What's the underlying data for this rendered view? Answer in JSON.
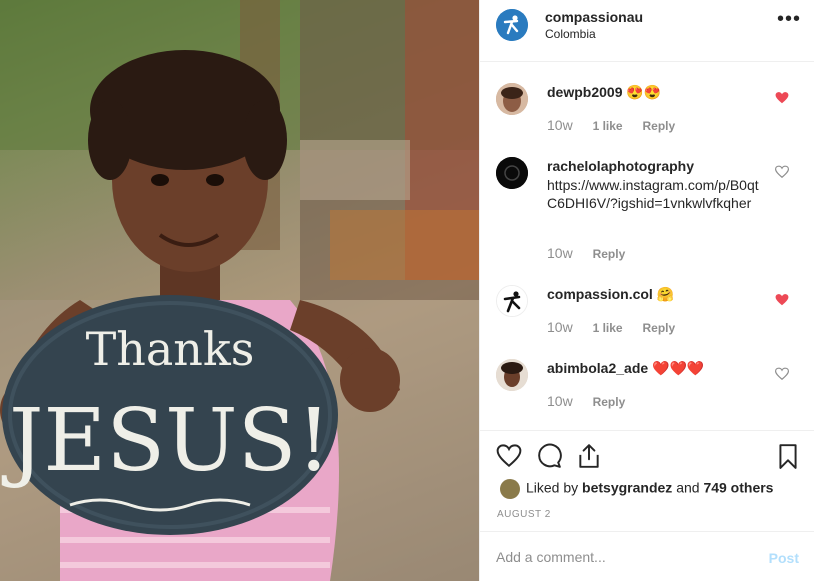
{
  "post": {
    "photo_text_line1": "Thanks",
    "photo_text_line2": "JESUS!"
  },
  "header": {
    "username": "compassionau",
    "location": "Colombia",
    "more_icon": "more-horizontal-icon",
    "more_label": "•••"
  },
  "comments": [
    {
      "username": "dewpb2009",
      "emoji": "😍😍",
      "text": "",
      "time": "10w",
      "likes": "1 like",
      "reply": "Reply",
      "liked": true
    },
    {
      "username": "rachelolaphotography",
      "emoji": "",
      "text": "https://www.instagram.com/p/B0qtC6DHI6V/?igshid=1vnkwlvfkqher",
      "time": "10w",
      "likes": "",
      "reply": "Reply",
      "liked": false
    },
    {
      "username": "compassion.col",
      "emoji": "🤗",
      "text": "",
      "time": "10w",
      "likes": "1 like",
      "reply": "Reply",
      "liked": true
    },
    {
      "username": "abimbola2_ade",
      "emoji": "❤️❤️❤️",
      "text": "",
      "time": "10w",
      "likes": "",
      "reply": "Reply",
      "liked": false
    }
  ],
  "actions": {
    "liked_by_prefix": "Liked by",
    "liked_by_user": "betsygrandez",
    "liked_by_and": "and",
    "liked_by_others": "749 others",
    "date": "AUGUST 2"
  },
  "add_comment": {
    "placeholder": "Add a comment...",
    "post_label": "Post"
  },
  "colors": {
    "heart_red": "#ed4956",
    "muted": "#8e8e8e",
    "post_disabled": "#b2dffc",
    "brand_blue": "#2a7bbf"
  }
}
